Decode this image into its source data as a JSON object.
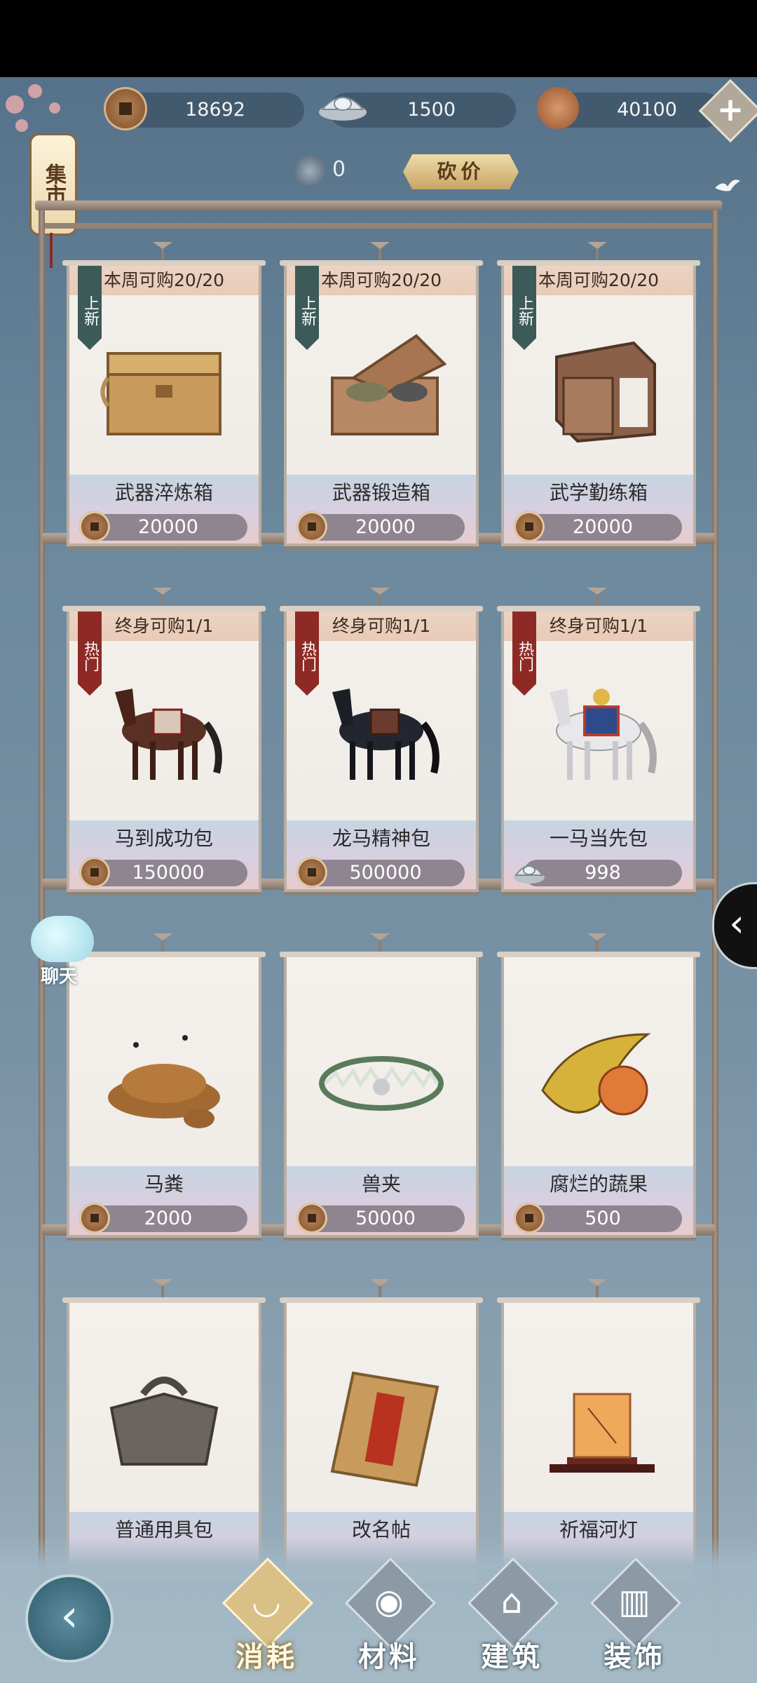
{
  "currency": {
    "copper": "18692",
    "silver": "1500",
    "shell": "40100",
    "add_label": "+"
  },
  "market_label": "集市",
  "bargain": {
    "count": "0",
    "button_label": "砍价"
  },
  "chat_label": "聊天",
  "side_tab_label": "‹",
  "back_label": "‹",
  "products": [
    {
      "tag": "上新",
      "tag_type": "new",
      "limit": "本周可购20/20",
      "name": "武器淬炼箱",
      "price": "20000",
      "currency": "copper",
      "icon": "wooden-chest-icon"
    },
    {
      "tag": "上新",
      "tag_type": "new",
      "limit": "本周可购20/20",
      "name": "武器锻造箱",
      "price": "20000",
      "currency": "copper",
      "icon": "open-box-icon"
    },
    {
      "tag": "上新",
      "tag_type": "new",
      "limit": "本周可购20/20",
      "name": "武学勤练箱",
      "price": "20000",
      "currency": "copper",
      "icon": "book-case-icon"
    },
    {
      "tag": "热门",
      "tag_type": "hot",
      "limit": "终身可购1/1",
      "name": "马到成功包",
      "price": "150000",
      "currency": "copper",
      "icon": "brown-horse-icon"
    },
    {
      "tag": "热门",
      "tag_type": "hot",
      "limit": "终身可购1/1",
      "name": "龙马精神包",
      "price": "500000",
      "currency": "copper",
      "icon": "black-horse-icon"
    },
    {
      "tag": "热门",
      "tag_type": "hot",
      "limit": "终身可购1/1",
      "name": "一马当先包",
      "price": "998",
      "currency": "silver",
      "icon": "white-horse-icon"
    },
    {
      "tag": "",
      "tag_type": "",
      "limit": "",
      "name": "马粪",
      "price": "2000",
      "currency": "copper",
      "icon": "dung-icon"
    },
    {
      "tag": "",
      "tag_type": "",
      "limit": "",
      "name": "兽夹",
      "price": "50000",
      "currency": "copper",
      "icon": "beast-trap-icon"
    },
    {
      "tag": "",
      "tag_type": "",
      "limit": "",
      "name": "腐烂的蔬果",
      "price": "500",
      "currency": "copper",
      "icon": "rotten-fruit-icon"
    },
    {
      "tag": "",
      "tag_type": "",
      "limit": "",
      "name": "普通用具包",
      "price": "",
      "currency": "",
      "icon": "cloth-bundle-icon"
    },
    {
      "tag": "",
      "tag_type": "",
      "limit": "",
      "name": "改名帖",
      "price": "",
      "currency": "",
      "icon": "rename-card-icon"
    },
    {
      "tag": "",
      "tag_type": "",
      "limit": "",
      "name": "祈福河灯",
      "price": "",
      "currency": "",
      "icon": "river-lantern-icon"
    }
  ],
  "nav": [
    {
      "label": "消耗",
      "active": true,
      "icon": "bowl-icon"
    },
    {
      "label": "材料",
      "active": false,
      "icon": "materials-icon"
    },
    {
      "label": "建筑",
      "active": false,
      "icon": "building-icon"
    },
    {
      "label": "装饰",
      "active": false,
      "icon": "decoration-icon"
    }
  ],
  "colors": {
    "tag_new": "#3c5a57",
    "tag_hot": "#8e2a25",
    "price_pill": "#8e8590",
    "nav_active": "#d9c087"
  }
}
